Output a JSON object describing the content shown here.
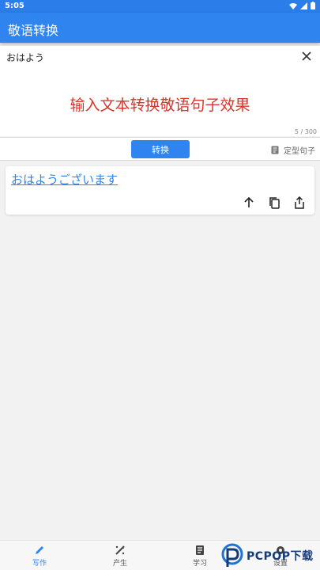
{
  "status_bar": {
    "time": "5:05"
  },
  "app_bar": {
    "title": "敬语转换"
  },
  "input": {
    "value": "おはよう",
    "counter": "5 / 300",
    "promo": "输入文本转换敬语句子效果"
  },
  "actions": {
    "convert_label": "转换",
    "template_label": "定型句子"
  },
  "result": {
    "text": "おはようございます"
  },
  "nav": {
    "items": [
      {
        "label": "写作"
      },
      {
        "label": "产生"
      },
      {
        "label": "学习"
      },
      {
        "label": "设置"
      }
    ]
  },
  "watermark": {
    "text": "PCPOP下载"
  },
  "colors": {
    "primary": "#2f84f0",
    "promo": "#d9342b"
  }
}
